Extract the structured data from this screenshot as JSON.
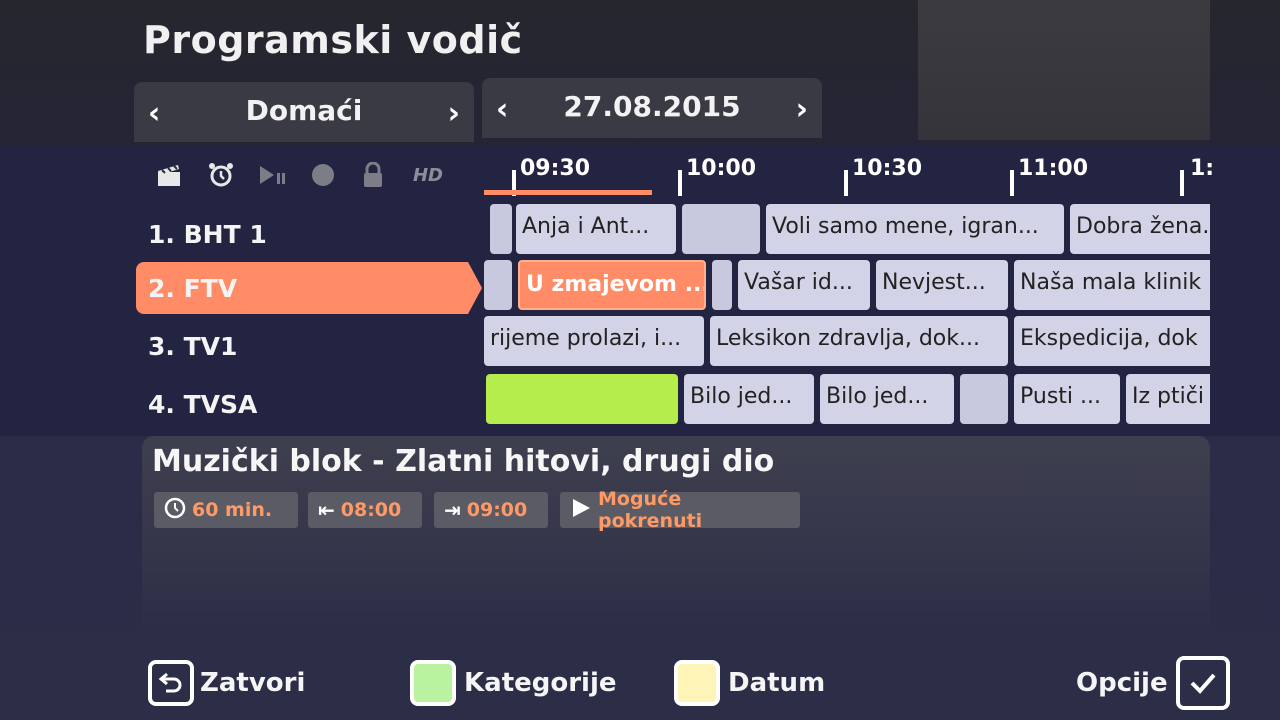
{
  "page_title": "Programski vodič",
  "category": {
    "label": "Domaći",
    "prev": "‹",
    "next": "›"
  },
  "date": {
    "label": "27.08.2015",
    "prev": "‹",
    "next": "›"
  },
  "icons": {
    "hd_label": "HD"
  },
  "channels": [
    {
      "label": "1. BHT 1"
    },
    {
      "label": "2. FTV"
    },
    {
      "label": "3. TV1"
    },
    {
      "label": "4. TVSA"
    }
  ],
  "timeline": {
    "ticks": [
      "09:30",
      "10:00",
      "10:30",
      "11:00",
      "1:"
    ]
  },
  "programs": {
    "row1": [
      "",
      "Anja i Ant...",
      "",
      "Voli samo mene, igran...",
      "Dobra žena."
    ],
    "row2": [
      "",
      "U zmajevom ...",
      "",
      "Vašar id...",
      "Nevjest...",
      "Naša mala klinik"
    ],
    "row3": [
      "rijeme prolazi, i...",
      "Leksikon zdravlja, dok...",
      "Ekspedicija, dok"
    ],
    "row4": [
      "",
      "Bilo jed...",
      "Bilo jed...",
      "",
      "Pusti ...",
      "Iz ptiči"
    ]
  },
  "details": {
    "title": "Muzički blok - Zlatni hitovi, drugi dio",
    "duration": "60 min.",
    "start": "08:00",
    "end": "09:00",
    "status": "Moguće pokrenuti"
  },
  "footer": {
    "close": "Zatvori",
    "categories": "Kategorije",
    "date": "Datum",
    "options": "Opcije"
  }
}
